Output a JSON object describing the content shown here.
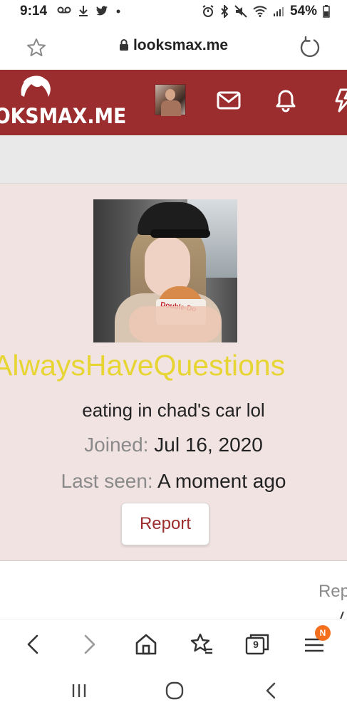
{
  "status_bar": {
    "time": "9:14",
    "battery": "54%",
    "icons": [
      "voicemail-icon",
      "download-icon",
      "twitter-icon",
      "dot-icon",
      "alarm-icon",
      "bluetooth-icon",
      "mute-icon",
      "wifi-icon",
      "signal-icon",
      "battery-icon"
    ]
  },
  "url_bar": {
    "domain": "looksmax.me"
  },
  "site_header": {
    "logo_text": "OKSMAX.ME",
    "brand_color": "#9b2d2f"
  },
  "profile": {
    "username": "AlwaysHaveQuestions",
    "username_color": "#e6d532",
    "status": "eating in chad's car lol",
    "joined_label": "Joined:",
    "joined_value": "Jul 16, 2020",
    "last_seen_label": "Last seen:",
    "last_seen_value": "A moment ago",
    "report_label": "Report",
    "photo_text": "Double-Do"
  },
  "tabs_partial": {
    "label": "Rep"
  },
  "browser_nav": {
    "tabs_count": "9",
    "menu_badge": "N"
  }
}
